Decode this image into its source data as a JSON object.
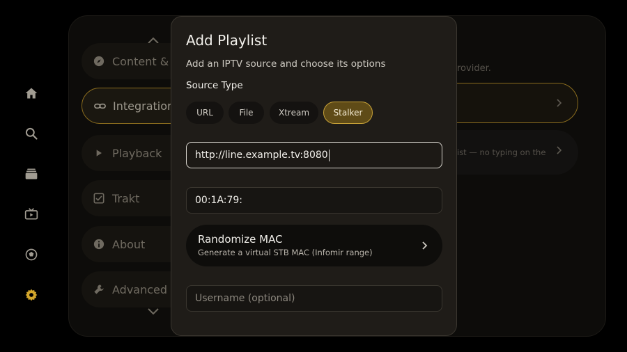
{
  "rail": {
    "icons": [
      "home-icon",
      "search-icon",
      "library-icon",
      "live-tv-icon",
      "sports-icon",
      "settings-icon"
    ],
    "active_color": "#d4a72c",
    "inactive_color": "#a19c92"
  },
  "settings_menu": {
    "items": [
      {
        "label": "Content & D",
        "icon": "compass-icon"
      },
      {
        "label": "Integrations",
        "icon": "link-icon",
        "active": true
      },
      {
        "label": "Playback",
        "icon": "play-icon"
      },
      {
        "label": "Trakt",
        "icon": "checkbox-icon"
      },
      {
        "label": "About",
        "icon": "info-icon"
      },
      {
        "label": "Advanced",
        "icon": "wrench-icon"
      }
    ]
  },
  "right_panel": {
    "provider_text": "rovider.",
    "card2_text": "ist — no typing on the"
  },
  "modal": {
    "title": "Add Playlist",
    "subtitle": "Add an IPTV source and choose its options",
    "source_type_label": "Source Type",
    "source_types": [
      "URL",
      "File",
      "Xtream",
      "Stalker"
    ],
    "selected_source_type": "Stalker",
    "portal_url_value": "http://line.example.tv:8080",
    "mac_value": "00:1A:79:",
    "randomize_title": "Randomize MAC",
    "randomize_subtitle": "Generate a virtual STB MAC (Infomir range)",
    "username_placeholder": "Username (optional)",
    "accent_color": "#c9a338"
  }
}
